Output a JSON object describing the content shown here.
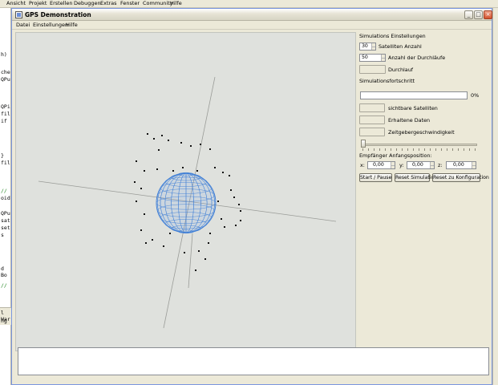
{
  "ide": {
    "menu": [
      "Ansicht",
      "Projekt",
      "Erstellen",
      "Debuggen",
      "Extras",
      "Fenster",
      "Community",
      "Hilfe"
    ],
    "code_fragments": [
      "h)",
      "che",
      "QPu",
      "QPi",
      "fil",
      "if",
      "}",
      "fil",
      "//",
      "oid",
      "QPu",
      "sat",
      "set",
      "s",
      "d Bo",
      "//",
      "l War",
      "ng"
    ]
  },
  "window": {
    "title": "GPS Demonstration",
    "buttons": {
      "minimize": "_",
      "maximize": "□",
      "close": "×"
    },
    "menu": [
      "Datei",
      "Einstellungen",
      "Hilfe"
    ]
  },
  "panel": {
    "sim_settings_title": "Simulations Einstellungen",
    "satellites_value": "30",
    "satellites_label": "Satelliten Anzahl",
    "runs_value": "50",
    "runs_label": "Anzahl der Durchläufe",
    "run_label": "Durchlauf",
    "progress_title": "Simulationsfortschritt",
    "progress_value": 0,
    "progress_text": "0%",
    "visible_sats_label": "sichtbare Satelliten",
    "received_data_label": "Erhaltene Daten",
    "time_speed_label": "Zeitgebergeschwindigkeit",
    "time_speed_value": 0,
    "receiver_title": "Empfänger Anfangsposition:",
    "x_label": "x:",
    "x_value": "0,00",
    "y_label": "y:",
    "y_value": "0,00",
    "z_label": "z:",
    "z_value": "0,00",
    "start_button": "Start / Pause",
    "reset_sim_button": "Reset Simulation",
    "reset_config_button": "Reset zu Konfiguration"
  },
  "colors": {
    "globe": "#3f7fd6",
    "viewport_bg": "#dfe1dd",
    "axis": "#9a9c98",
    "satellite": "#111111"
  },
  "icons": {
    "app": "window-icon",
    "minimize": "minimize-icon",
    "maximize": "maximize-icon",
    "close": "close-icon"
  }
}
